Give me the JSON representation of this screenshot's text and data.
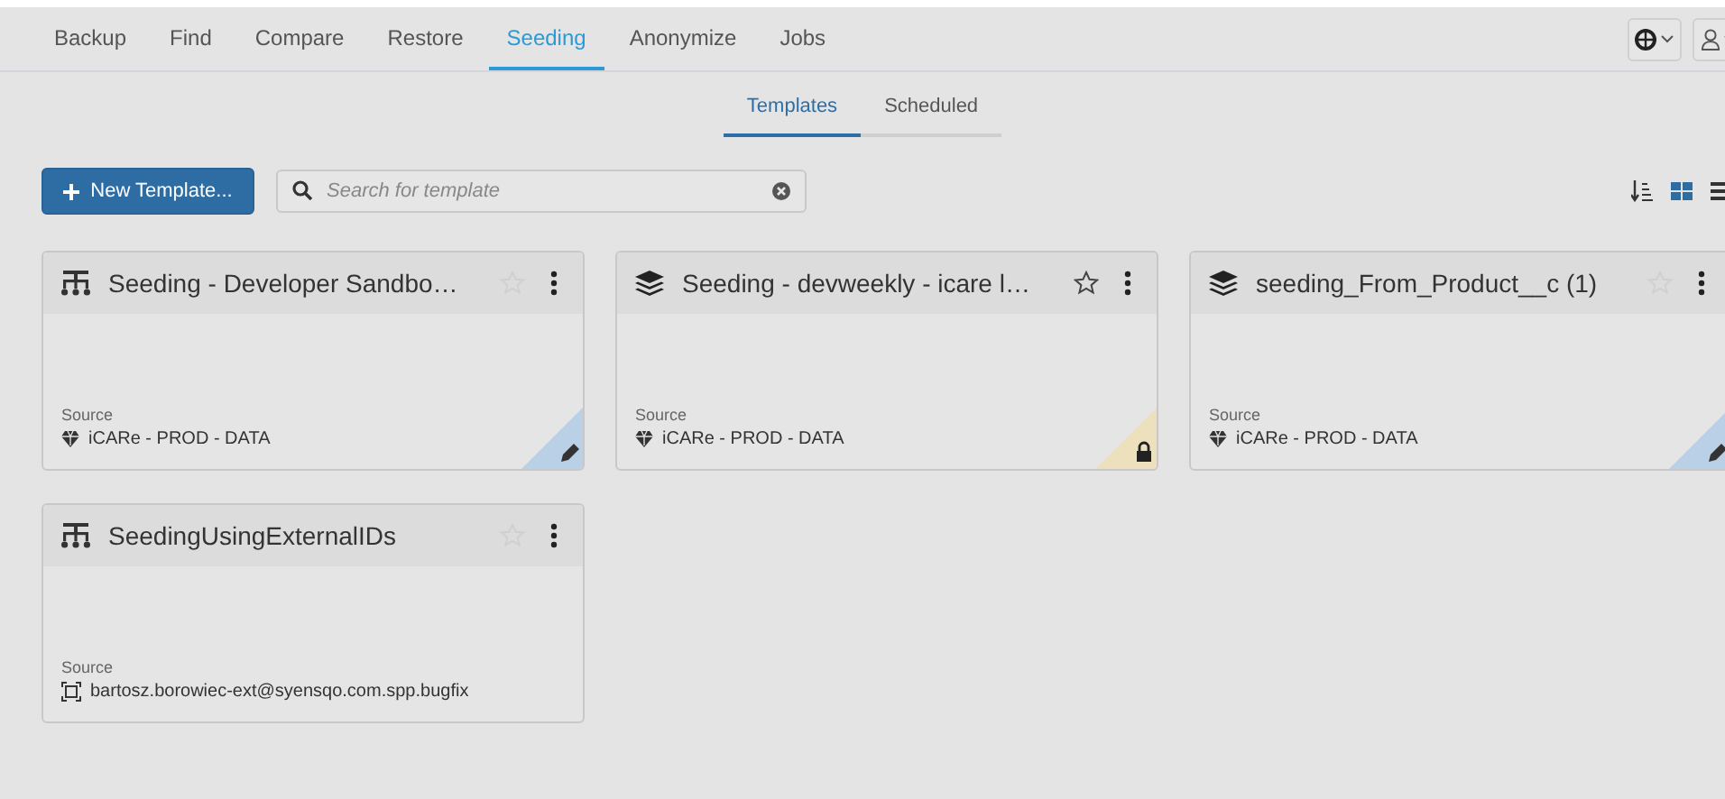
{
  "nav": {
    "tabs": [
      {
        "label": "Backup",
        "selected": false
      },
      {
        "label": "Find",
        "selected": false
      },
      {
        "label": "Compare",
        "selected": false
      },
      {
        "label": "Restore",
        "selected": false
      },
      {
        "label": "Seeding",
        "selected": true
      },
      {
        "label": "Anonymize",
        "selected": false
      },
      {
        "label": "Jobs",
        "selected": false
      }
    ]
  },
  "subtabs": [
    {
      "label": "Templates",
      "selected": true
    },
    {
      "label": "Scheduled",
      "selected": false
    }
  ],
  "toolbar": {
    "new_button": "New Template...",
    "search": {
      "placeholder": "Search for template"
    },
    "views": [
      {
        "kind": "grid",
        "selected": true
      },
      {
        "kind": "list",
        "selected": false
      }
    ]
  },
  "cards": [
    {
      "kind": "hierarchy",
      "title": "Seeding - Developer Sandbo…",
      "star_highlighted": false,
      "source": {
        "kind": "database",
        "label": "Source",
        "name": "iCARe - PROD - DATA"
      },
      "editable": true,
      "locked": false
    },
    {
      "kind": "layers",
      "title": "Seeding - devweekly - icare l…",
      "star_highlighted": true,
      "source": {
        "kind": "database",
        "label": "Source",
        "name": "iCARe - PROD - DATA"
      },
      "editable": false,
      "locked": true
    },
    {
      "kind": "layers",
      "title": "seeding_From_Product__c (1)",
      "star_highlighted": false,
      "source": {
        "kind": "database",
        "label": "Source",
        "name": "iCARe - PROD - DATA"
      },
      "editable": true,
      "locked": false
    },
    {
      "kind": "hierarchy",
      "title": "SeedingUsingExternalIDs",
      "star_highlighted": false,
      "source": {
        "kind": "sandbox",
        "label": "Source",
        "name": "bartosz.borowiec-ext@syensqo.com.spp.bugfix"
      },
      "editable": false,
      "locked": false
    }
  ]
}
